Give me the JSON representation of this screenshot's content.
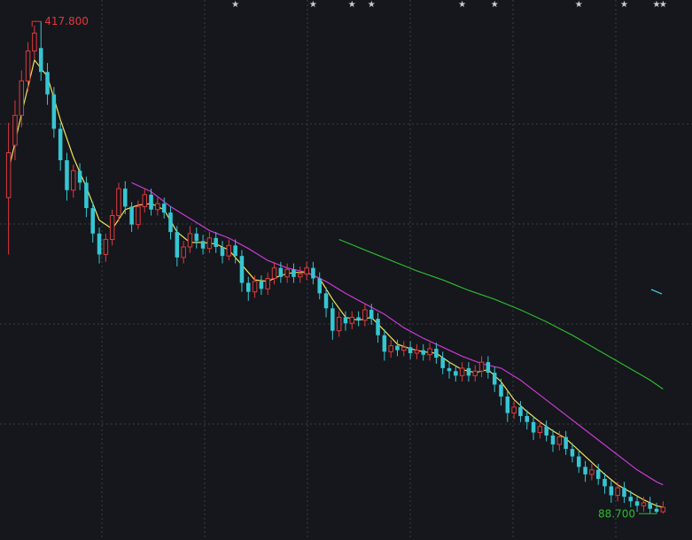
{
  "chart_data": {
    "type": "candlestick",
    "title": "",
    "xlabel": "",
    "ylabel": "",
    "ylim": [
      80,
      425
    ],
    "grid": true,
    "max_label": "417.800",
    "min_label": "88.700",
    "colors": {
      "background": "#15171c",
      "grid": "#3a3d44",
      "up": "#e0393e",
      "down": "#36c6d3",
      "ma_short": "#f0e35a",
      "ma_mid": "#c93ad3",
      "ma_long": "#2fb82f",
      "max_label": "#e0393e",
      "min_label": "#2fb82f",
      "star": "#cccccc"
    },
    "event_marks": [
      36,
      48,
      54,
      57,
      71,
      76,
      89,
      96,
      101,
      102
    ],
    "series": [
      {
        "name": "",
        "kind": "ohlc",
        "values": [
          [
            1,
            300,
            330,
            262,
            350
          ],
          [
            2,
            335,
            355,
            325,
            365
          ],
          [
            3,
            355,
            378,
            347,
            385
          ],
          [
            4,
            378,
            398,
            371,
            404
          ],
          [
            5,
            398,
            410,
            392,
            415
          ],
          [
            6,
            400,
            384,
            378,
            417.8
          ],
          [
            7,
            384,
            369,
            362,
            390
          ],
          [
            8,
            369,
            346,
            340,
            374
          ],
          [
            9,
            346,
            325,
            318,
            350
          ],
          [
            10,
            325,
            305,
            298,
            330
          ],
          [
            11,
            305,
            318,
            300,
            322
          ],
          [
            12,
            318,
            310,
            305,
            323
          ],
          [
            13,
            310,
            293,
            287,
            314
          ],
          [
            14,
            293,
            276,
            270,
            297
          ],
          [
            15,
            276,
            262,
            256,
            280
          ],
          [
            16,
            262,
            272,
            257,
            276
          ],
          [
            17,
            272,
            288,
            268,
            292
          ],
          [
            18,
            288,
            306,
            284,
            310
          ],
          [
            19,
            306,
            294,
            289,
            311
          ],
          [
            20,
            294,
            282,
            277,
            297
          ],
          [
            21,
            282,
            294,
            279,
            298
          ],
          [
            22,
            294,
            302,
            290,
            306
          ],
          [
            23,
            302,
            292,
            288,
            306
          ],
          [
            24,
            292,
            296,
            288,
            300
          ],
          [
            25,
            296,
            290,
            286,
            300
          ],
          [
            26,
            290,
            277,
            272,
            294
          ],
          [
            27,
            277,
            260,
            254,
            281
          ],
          [
            28,
            260,
            267,
            256,
            271
          ],
          [
            29,
            267,
            276,
            263,
            281
          ],
          [
            30,
            276,
            271,
            266,
            280
          ],
          [
            31,
            271,
            266,
            262,
            275
          ],
          [
            32,
            266,
            273,
            263,
            277
          ],
          [
            33,
            273,
            267,
            263,
            277
          ],
          [
            34,
            267,
            261,
            256,
            271
          ],
          [
            35,
            261,
            268,
            258,
            272
          ],
          [
            36,
            268,
            261,
            256,
            272
          ],
          [
            37,
            261,
            243,
            237,
            265
          ],
          [
            38,
            243,
            237,
            231,
            247
          ],
          [
            39,
            237,
            244,
            233,
            248
          ],
          [
            40,
            244,
            239,
            235,
            248
          ],
          [
            41,
            239,
            246,
            235,
            250
          ],
          [
            42,
            246,
            253,
            242,
            257
          ],
          [
            43,
            253,
            247,
            243,
            257
          ],
          [
            44,
            247,
            252,
            243,
            256
          ],
          [
            45,
            252,
            247,
            243,
            256
          ],
          [
            46,
            247,
            249,
            243,
            254
          ],
          [
            47,
            249,
            253,
            245,
            257
          ],
          [
            48,
            253,
            246,
            242,
            257
          ],
          [
            49,
            246,
            236,
            232,
            250
          ],
          [
            50,
            236,
            226,
            220,
            240
          ],
          [
            51,
            226,
            211,
            205,
            230
          ],
          [
            52,
            211,
            220,
            207,
            224
          ],
          [
            53,
            220,
            216,
            211,
            224
          ],
          [
            54,
            216,
            220,
            212,
            224
          ],
          [
            55,
            220,
            218,
            214,
            224
          ],
          [
            56,
            218,
            225,
            214,
            229
          ],
          [
            57,
            225,
            219,
            215,
            229
          ],
          [
            58,
            219,
            208,
            203,
            223
          ],
          [
            59,
            208,
            197,
            191,
            212
          ],
          [
            60,
            197,
            201,
            193,
            205
          ],
          [
            61,
            201,
            198,
            194,
            205
          ],
          [
            62,
            198,
            200,
            194,
            204
          ],
          [
            63,
            200,
            196,
            192,
            204
          ],
          [
            64,
            196,
            198,
            192,
            202
          ],
          [
            65,
            198,
            195,
            191,
            202
          ],
          [
            66,
            195,
            199,
            191,
            203
          ],
          [
            67,
            199,
            193,
            189,
            203
          ],
          [
            68,
            193,
            186,
            182,
            197
          ],
          [
            69,
            186,
            184,
            179,
            190
          ],
          [
            70,
            184,
            181,
            177,
            188
          ],
          [
            71,
            181,
            186,
            177,
            190
          ],
          [
            72,
            186,
            181,
            177,
            190
          ],
          [
            73,
            181,
            184,
            177,
            188
          ],
          [
            74,
            184,
            190,
            180,
            194
          ],
          [
            75,
            190,
            183,
            179,
            194
          ],
          [
            76,
            183,
            175,
            170,
            187
          ],
          [
            77,
            175,
            167,
            161,
            179
          ],
          [
            78,
            167,
            156,
            150,
            171
          ],
          [
            79,
            156,
            160,
            152,
            164
          ],
          [
            80,
            160,
            154,
            150,
            164
          ],
          [
            81,
            154,
            150,
            145,
            158
          ],
          [
            82,
            150,
            143,
            138,
            154
          ],
          [
            83,
            143,
            147,
            139,
            151
          ],
          [
            84,
            147,
            141,
            137,
            151
          ],
          [
            85,
            141,
            135,
            130,
            145
          ],
          [
            86,
            135,
            140,
            131,
            144
          ],
          [
            87,
            140,
            132,
            128,
            144
          ],
          [
            88,
            132,
            127,
            123,
            136
          ],
          [
            89,
            127,
            120,
            116,
            131
          ],
          [
            90,
            120,
            115,
            110,
            124
          ],
          [
            91,
            115,
            118,
            111,
            122
          ],
          [
            92,
            118,
            112,
            108,
            122
          ],
          [
            93,
            112,
            107,
            102,
            116
          ],
          [
            94,
            107,
            101,
            96,
            111
          ],
          [
            95,
            101,
            106,
            97,
            110
          ],
          [
            96,
            106,
            100,
            96,
            110
          ],
          [
            97,
            100,
            97,
            93,
            104
          ],
          [
            98,
            97,
            94,
            90,
            101
          ],
          [
            99,
            94,
            96,
            90,
            100
          ],
          [
            100,
            96,
            92,
            89,
            100
          ],
          [
            101,
            92,
            90,
            88.7,
            96
          ],
          [
            102,
            90,
            93,
            88.7,
            97
          ]
        ]
      },
      {
        "name": "",
        "kind": "ma",
        "color_key": "ma_short",
        "values": [
          [
            1,
            318
          ],
          [
            3,
            356
          ],
          [
            5,
            392
          ],
          [
            7,
            381
          ],
          [
            9,
            352
          ],
          [
            11,
            327
          ],
          [
            13,
            307
          ],
          [
            15,
            285
          ],
          [
            17,
            279
          ],
          [
            19,
            292
          ],
          [
            21,
            295
          ],
          [
            23,
            296
          ],
          [
            25,
            292
          ],
          [
            27,
            277
          ],
          [
            29,
            270
          ],
          [
            31,
            270
          ],
          [
            33,
            269
          ],
          [
            35,
            265
          ],
          [
            37,
            255
          ],
          [
            39,
            245
          ],
          [
            41,
            244
          ],
          [
            43,
            248
          ],
          [
            45,
            250
          ],
          [
            47,
            250
          ],
          [
            49,
            246
          ],
          [
            51,
            232
          ],
          [
            53,
            220
          ],
          [
            55,
            218
          ],
          [
            57,
            220
          ],
          [
            59,
            211
          ],
          [
            61,
            202
          ],
          [
            63,
            199
          ],
          [
            65,
            197
          ],
          [
            67,
            196
          ],
          [
            69,
            190
          ],
          [
            71,
            185
          ],
          [
            73,
            183
          ],
          [
            75,
            185
          ],
          [
            77,
            177
          ],
          [
            79,
            165
          ],
          [
            81,
            157
          ],
          [
            83,
            150
          ],
          [
            85,
            144
          ],
          [
            87,
            139
          ],
          [
            89,
            131
          ],
          [
            91,
            123
          ],
          [
            93,
            115
          ],
          [
            95,
            108
          ],
          [
            97,
            103
          ],
          [
            99,
            98
          ],
          [
            101,
            94
          ],
          [
            102,
            93
          ]
        ]
      },
      {
        "name": "",
        "kind": "ma",
        "color_key": "ma_mid",
        "values": [
          [
            20,
            310
          ],
          [
            23,
            304
          ],
          [
            26,
            294
          ],
          [
            29,
            286
          ],
          [
            32,
            278
          ],
          [
            35,
            273
          ],
          [
            38,
            266
          ],
          [
            41,
            258
          ],
          [
            44,
            253
          ],
          [
            47,
            250
          ],
          [
            50,
            244
          ],
          [
            53,
            236
          ],
          [
            56,
            229
          ],
          [
            59,
            222
          ],
          [
            62,
            213
          ],
          [
            65,
            206
          ],
          [
            68,
            200
          ],
          [
            71,
            194
          ],
          [
            74,
            189
          ],
          [
            77,
            186
          ],
          [
            80,
            178
          ],
          [
            83,
            168
          ],
          [
            86,
            158
          ],
          [
            89,
            148
          ],
          [
            92,
            138
          ],
          [
            95,
            128
          ],
          [
            98,
            118
          ],
          [
            101,
            110
          ],
          [
            102,
            108
          ]
        ]
      },
      {
        "name": "",
        "kind": "ma",
        "color_key": "ma_long",
        "values": [
          [
            52,
            272
          ],
          [
            56,
            265
          ],
          [
            60,
            258
          ],
          [
            64,
            251
          ],
          [
            68,
            245
          ],
          [
            72,
            238
          ],
          [
            76,
            232
          ],
          [
            80,
            225
          ],
          [
            84,
            217
          ],
          [
            88,
            208
          ],
          [
            92,
            198
          ],
          [
            96,
            188
          ],
          [
            100,
            178
          ],
          [
            102,
            172
          ]
        ]
      }
    ]
  }
}
